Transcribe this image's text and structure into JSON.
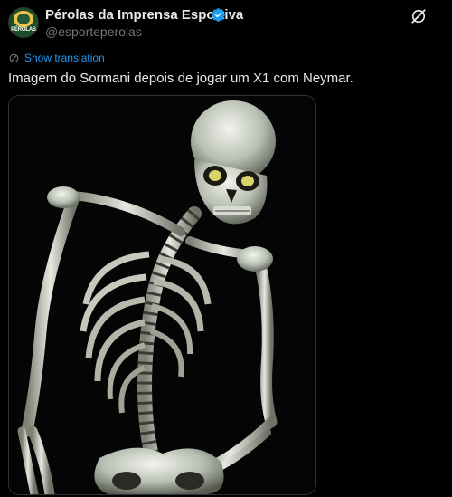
{
  "author": {
    "display_name": "Pérolas da Imprensa Esportiva",
    "handle": "@esporteperolas",
    "avatar_text": "PÉROLAS",
    "verified": true
  },
  "icons": {
    "verified": "verified-badge-icon",
    "grok": "grok-icon",
    "translate": "translate-icon"
  },
  "translate_label": "Show translation",
  "tweet": {
    "text": "Imagem do Sormani depois de jogar um X1 com Neymar."
  },
  "colors": {
    "background": "#000000",
    "text": "#e7e9ea",
    "muted": "#71767b",
    "accent": "#1d9bf0"
  }
}
